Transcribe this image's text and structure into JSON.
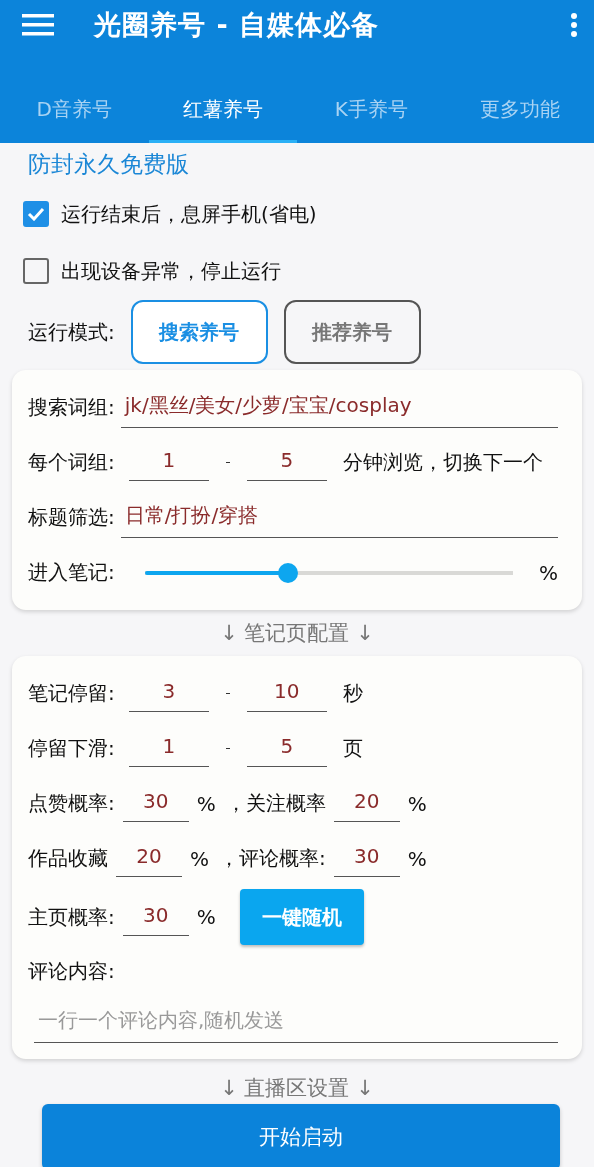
{
  "app_bar": {
    "title": "光圈养号 - 自媒体必备"
  },
  "tabs": [
    {
      "label": "D音养号",
      "selected": false
    },
    {
      "label": "红薯养号",
      "selected": true
    },
    {
      "label": "K手养号",
      "selected": false
    },
    {
      "label": "更多功能",
      "selected": false
    }
  ],
  "edition": "防封永久免费版",
  "options": [
    {
      "label": "运行结束后，息屏手机(省电)",
      "checked": true
    },
    {
      "label": "出现设备异常，停止运行",
      "checked": false
    }
  ],
  "run_mode": {
    "label": "运行模式:",
    "options": [
      {
        "label": "搜索养号",
        "selected": true
      },
      {
        "label": "推荐养号",
        "selected": false
      }
    ]
  },
  "search_card": {
    "rows": [
      {
        "kind": "text",
        "label": "搜索词组:",
        "value": "jk/黑丝/美女/少萝/宝宝/cosplay"
      },
      {
        "kind": "range",
        "label": "每个词组:",
        "from": "1",
        "to": "5",
        "suffix": "分钟浏览，切换下一个"
      },
      {
        "kind": "text",
        "label": "标题筛选:",
        "value": "日常/打扮/穿搭"
      },
      {
        "kind": "slider",
        "label": "进入笔记:",
        "level": 0.39,
        "suffix": "%"
      }
    ]
  },
  "note_section": "↓ 笔记页配置 ↓",
  "note_card": {
    "rows": [
      {
        "kind": "range",
        "label": "笔记停留:",
        "from": "3",
        "to": "10",
        "suffix": "秒"
      },
      {
        "kind": "range",
        "label": "停留下滑:",
        "from": "1",
        "to": "5",
        "suffix": "页"
      },
      {
        "kind": "pair",
        "items": [
          {
            "label": "点赞概率:",
            "value": "30",
            "unit": "%"
          },
          {
            "label": "，关注概率",
            "value": "20",
            "unit": "%"
          }
        ]
      },
      {
        "kind": "pair",
        "items": [
          {
            "label": "作品收藏",
            "value": "20",
            "unit": "%"
          },
          {
            "label": "，评论概率:",
            "value": "30",
            "unit": "%"
          }
        ]
      },
      {
        "kind": "button",
        "label": "主页概率:",
        "value": "30",
        "unit": "%",
        "button": "一键随机"
      },
      {
        "kind": "textarea",
        "label": "评论内容:",
        "placeholder": "一行一个评论内容,随机发送"
      }
    ]
  },
  "live_section": "↓ 直播区设置 ↓",
  "start_button": "开始启动"
}
